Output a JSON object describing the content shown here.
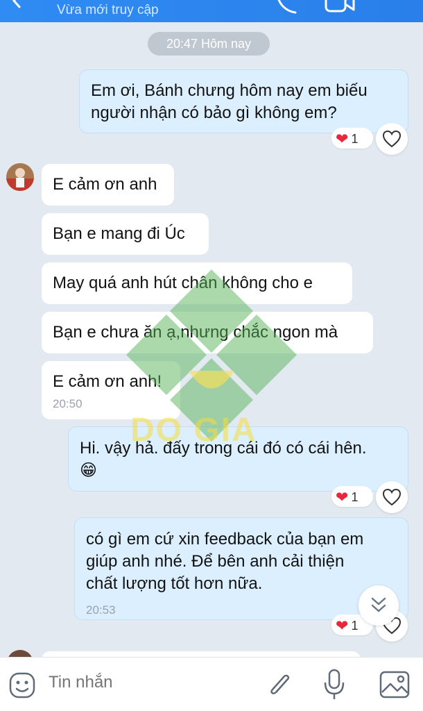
{
  "header": {
    "status": "Vừa mới truy cập"
  },
  "time_separator": "20:47 Hôm nay",
  "messages": {
    "m1": {
      "text": "Em ơi, Bánh chưng hôm nay em biếu\nngười nhận có bảo gì không em?",
      "reaction_count": "1"
    },
    "m2": {
      "text": "E cảm ơn anh"
    },
    "m3": {
      "text": "Bạn e mang đi Úc"
    },
    "m4": {
      "text": "May quá anh hút chân không cho e"
    },
    "m5": {
      "text": "Bạn e chưa ăn ạ,nhưng chắc ngon mà"
    },
    "m6": {
      "text": "E cảm ơn anh!",
      "time": "20:50"
    },
    "m7": {
      "text": "Hi. vậy hả. đấy trong cái đó có cái hên.\n😁",
      "reaction_count": "1"
    },
    "m8": {
      "text": "có gì em cứ xin feedback của bạn em\ngiúp anh nhé. Để bên anh cải thiện\nchất lượng tốt hơn nữa.",
      "time": "20:53",
      "reaction_count": "1"
    }
  },
  "watermark_text": "DO GIA",
  "composer": {
    "placeholder": "Tin nhắn"
  },
  "icons": {
    "back": "chevron-left-icon",
    "call": "phone-icon",
    "video": "video-icon",
    "like": "heart-outline-icon",
    "reaction": "heart-icon",
    "scroll": "chevron-double-down-icon",
    "emoji": "emoji-icon",
    "attach": "paperclip-icon",
    "mic": "microphone-icon",
    "image": "image-icon"
  },
  "colors": {
    "header": "#2f8cf3",
    "outgoing_bubble": "#dcefff",
    "incoming_bubble": "#ffffff",
    "background": "#e2e9f1",
    "reaction_heart": "#e8273d"
  }
}
